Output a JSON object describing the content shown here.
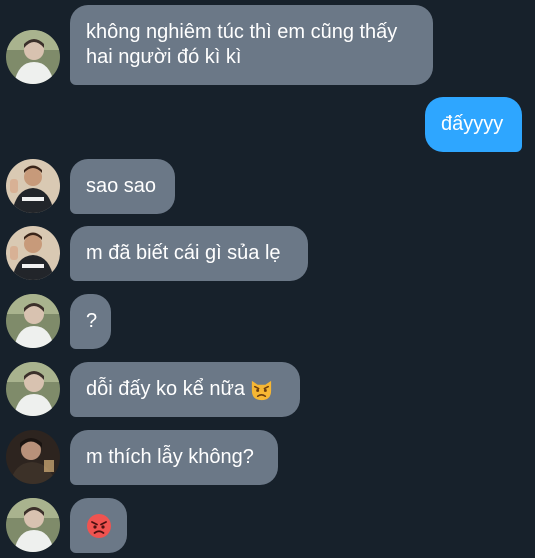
{
  "messages": [
    {
      "side": "in",
      "text": "không nghiêm túc thì em cũng thấy hai người đó kì kì"
    },
    {
      "side": "out",
      "text": "đấyyyy"
    },
    {
      "side": "in",
      "text": "sao sao"
    },
    {
      "side": "in",
      "text": "m đã biết cái gì sủa lẹ"
    },
    {
      "side": "in",
      "text": "?"
    },
    {
      "side": "in",
      "text": "dỗi đấy ko kể nữa",
      "emoji": "pouting-cat-emoji"
    },
    {
      "side": "in",
      "text": "m thích lẫy không?"
    },
    {
      "side": "in",
      "text": "",
      "emoji": "angry-face-emoji"
    }
  ],
  "colors": {
    "background": "#17212b",
    "incoming_bubble": "#6b7887",
    "outgoing_bubble": "#2ea6ff",
    "text": "#ffffff"
  }
}
